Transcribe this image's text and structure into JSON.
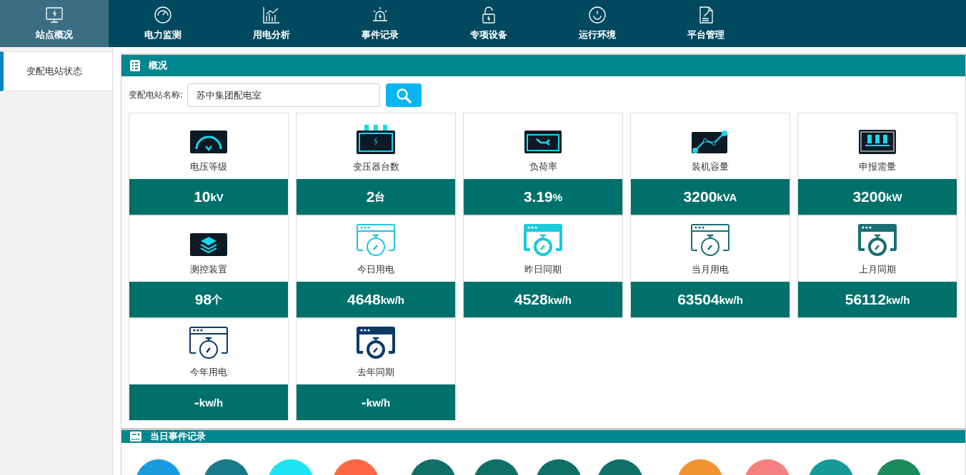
{
  "nav": [
    {
      "label": "站点概况",
      "selected": true
    },
    {
      "label": "电力监测",
      "selected": false
    },
    {
      "label": "用电分析",
      "selected": false
    },
    {
      "label": "事件记录",
      "selected": false
    },
    {
      "label": "专项设备",
      "selected": false
    },
    {
      "label": "运行环境",
      "selected": false
    },
    {
      "label": "平台管理",
      "selected": false
    }
  ],
  "sidebar": {
    "items": [
      {
        "label": "变配电站状态",
        "selected": true
      }
    ]
  },
  "overview": {
    "title": "概况",
    "search": {
      "label": "变配电站名称:",
      "value": "苏中集团配电室"
    },
    "cards": [
      {
        "label": "电压等级",
        "value": "10",
        "unit": "kV",
        "kind": "gauge"
      },
      {
        "label": "变压器台数",
        "value": "2",
        "unit": "台",
        "kind": "transformer"
      },
      {
        "label": "负荷率",
        "value": "3.19",
        "unit": "%",
        "kind": "wrench"
      },
      {
        "label": "装机容量",
        "value": "3200",
        "unit": "kVA",
        "kind": "linechart"
      },
      {
        "label": "申报需量",
        "value": "3200",
        "unit": "kW",
        "kind": "kva"
      },
      {
        "label": "测控装置",
        "value": "98",
        "unit": "个",
        "kind": "layers"
      },
      {
        "label": "今日用电",
        "value": "4648",
        "unit": "kw/h",
        "kind": "stopwatch",
        "color": "#1cc8dc",
        "filled": false
      },
      {
        "label": "昨日同期",
        "value": "4528",
        "unit": "kw/h",
        "kind": "stopwatch",
        "color": "#1cc8dc",
        "filled": true
      },
      {
        "label": "当月用电",
        "value": "63504",
        "unit": "kw/h",
        "kind": "stopwatch",
        "color": "#1a6f73",
        "filled": false
      },
      {
        "label": "上月同期",
        "value": "56112",
        "unit": "kw/h",
        "kind": "stopwatch",
        "color": "#1a6f73",
        "filled": true
      },
      {
        "label": "今年用电",
        "value": "-",
        "unit": "kw/h",
        "kind": "stopwatch",
        "color": "#0c3a66",
        "filled": false
      },
      {
        "label": "去年同期",
        "value": "-",
        "unit": "kw/h",
        "kind": "stopwatch",
        "color": "#0c3a66",
        "filled": true
      }
    ]
  },
  "events": {
    "title": "当日事件记录",
    "circles": [
      {
        "color": "#1a9be0"
      },
      {
        "color": "#187a86"
      },
      {
        "color": "#1de4f2"
      },
      {
        "color": "#ff6644"
      },
      {
        "color": "#0f7068"
      },
      {
        "color": "#0f7068"
      },
      {
        "color": "#0f7068"
      },
      {
        "color": "#0f7068"
      },
      {
        "color": "#f39231"
      },
      {
        "color": "#f58080"
      },
      {
        "color": "#17999a"
      },
      {
        "color": "#198a5c"
      }
    ]
  }
}
